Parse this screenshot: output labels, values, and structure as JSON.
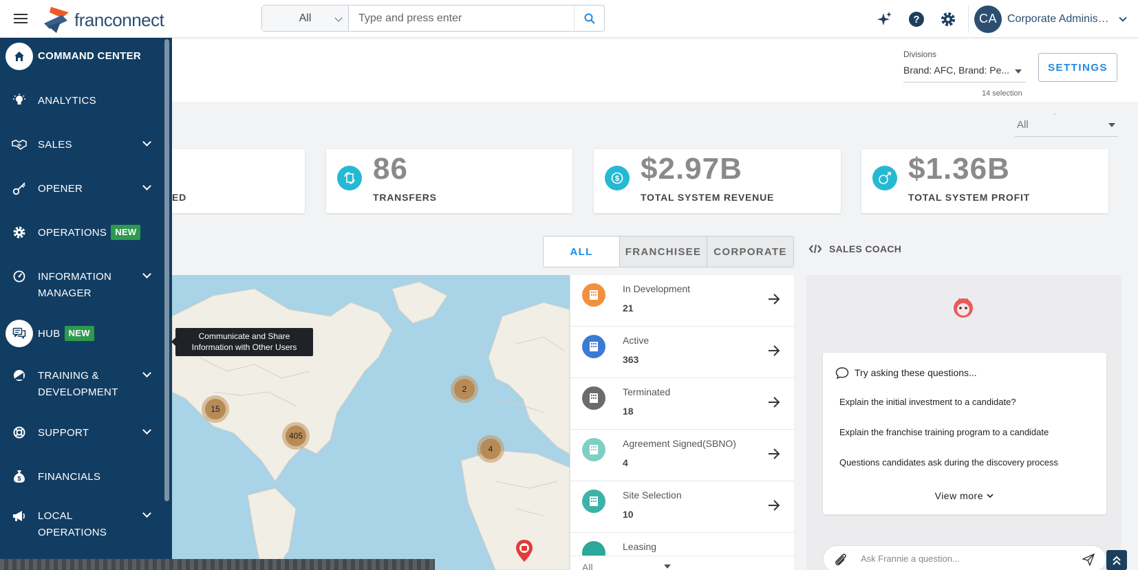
{
  "header": {
    "logo_text": "franconnect",
    "search": {
      "scope": "All",
      "placeholder": "Type and press enter"
    },
    "user": {
      "initials": "CA",
      "name": "Corporate Administr..."
    }
  },
  "sidebar": {
    "items": [
      {
        "label": "COMMAND CENTER",
        "icon": "home-icon"
      },
      {
        "label": "ANALYTICS",
        "icon": "lightbulb-icon"
      },
      {
        "label": "SALES",
        "icon": "handshake-icon"
      },
      {
        "label": "OPENER",
        "icon": "key-icon"
      },
      {
        "label": "OPERATIONS",
        "icon": "gear-icon",
        "badge": "NEW"
      },
      {
        "label": "INFORMATION",
        "label2": "MANAGER",
        "icon": "gauge-icon"
      },
      {
        "label": "HUB",
        "icon": "chat-icon",
        "badge": "NEW"
      },
      {
        "label": "TRAINING &",
        "label2": "DEVELOPMENT",
        "icon": "training-icon"
      },
      {
        "label": "SUPPORT",
        "icon": "lifebuoy-icon"
      },
      {
        "label": "FINANCIALS",
        "icon": "money-bag-icon"
      },
      {
        "label": "LOCAL",
        "label2": "OPERATIONS",
        "icon": "megaphone-icon"
      }
    ],
    "tooltip": {
      "line1": "Communicate and Share",
      "line2": "Information with Other Users"
    }
  },
  "divisions": {
    "label": "Divisions",
    "value": "Brand: AFC, Brand: Pe...",
    "count": "14 selection"
  },
  "settings_label": "SETTINGS",
  "filter": {
    "value": "All",
    "marker": "-"
  },
  "kpis": [
    {
      "value": "",
      "label": "ED"
    },
    {
      "value": "86",
      "label": "TRANSFERS"
    },
    {
      "value": "$2.97B",
      "label": "TOTAL SYSTEM REVENUE"
    },
    {
      "value": "$1.36B",
      "label": "TOTAL SYSTEM PROFIT"
    }
  ],
  "tabs": [
    "ALL",
    "FRANCHISEE",
    "CORPORATE"
  ],
  "sales_coach_label": "SALES COACH",
  "map_clusters": [
    "15",
    "405",
    "2",
    "4"
  ],
  "statuses": [
    {
      "name": "In Development",
      "count": "21",
      "color": "#f2913d"
    },
    {
      "name": "Active",
      "count": "363",
      "color": "#3a7bd5"
    },
    {
      "name": "Terminated",
      "count": "18",
      "color": "#6b6b6b"
    },
    {
      "name": "Agreement Signed(SBNO)",
      "count": "4",
      "color": "#7fcfc5"
    },
    {
      "name": "Site Selection",
      "count": "10",
      "color": "#3bb3a8"
    },
    {
      "name": "Leasing",
      "count": "",
      "color": "#2aa89a"
    }
  ],
  "status_filter": "All",
  "coach": {
    "heading": "Try asking these questions...",
    "questions": [
      "Explain the initial investment to a candidate?",
      "Explain the franchise training program to a candidate",
      "Questions candidates ask during the discovery process"
    ],
    "view_more": "View more",
    "ask_placeholder": "Ask Frannie a question..."
  },
  "colors": {
    "sidebar": "#123d62",
    "accent": "#1e88e5",
    "highlight": "#f29322",
    "badge": "#2e9a4e",
    "kpi_icon": "#26b9d3"
  }
}
